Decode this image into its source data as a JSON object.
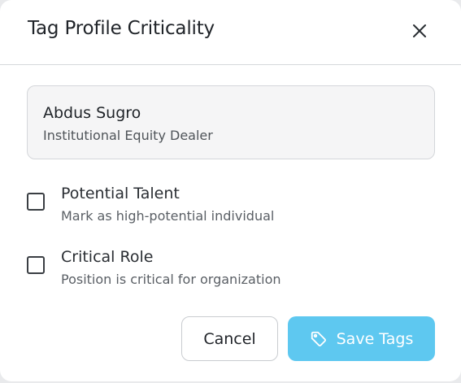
{
  "dialog": {
    "title": "Tag Profile Criticality",
    "close_icon": "close-icon"
  },
  "profile": {
    "name": "Abdus Sugro",
    "role": "Institutional Equity Dealer"
  },
  "options": [
    {
      "label": "Potential Talent",
      "description": "Mark as high-potential individual",
      "checked": false
    },
    {
      "label": "Critical Role",
      "description": "Position is critical for organization",
      "checked": false
    }
  ],
  "actions": {
    "cancel_label": "Cancel",
    "save_label": "Save Tags",
    "save_icon": "tag-icon"
  },
  "colors": {
    "primary": "#5ec8f0",
    "card_bg": "#f5f5f6",
    "text": "#1f2328"
  }
}
